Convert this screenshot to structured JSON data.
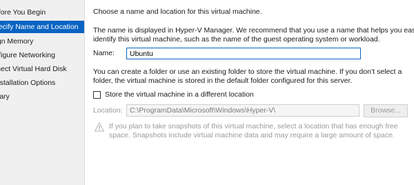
{
  "sidebar": {
    "items": [
      {
        "label": "Before You Begin",
        "active": false
      },
      {
        "label": "Specify Name and Location",
        "active": true
      },
      {
        "label": "Assign Memory",
        "active": false
      },
      {
        "label": "Configure Networking",
        "active": false
      },
      {
        "label": "Connect Virtual Hard Disk",
        "active": false
      },
      {
        "label": "Installation Options",
        "active": false
      },
      {
        "label": "Summary",
        "active": false
      }
    ]
  },
  "main": {
    "heading": "Choose a name and location for this virtual machine.",
    "description_line1": "The name is displayed in Hyper-V Manager. We recommend that you use a name that helps you easily",
    "description_line2": "identify this virtual machine, such as the name of the guest operating system or workload.",
    "name_label": "Name:",
    "name_value": "Ubuntu",
    "folder_line1": "You can create a folder or use an existing folder to store the virtual machine. If you don’t select a",
    "folder_line2": "folder, the virtual machine is stored in the default folder configured for this server.",
    "store_checkbox_label": "Store the virtual machine in a different location",
    "store_checked": false,
    "location_label": "Location:",
    "location_value": "C:\\ProgramData\\Microsoft\\Windows\\Hyper-V\\",
    "browse_label": "Browse...",
    "warning_line1": "If you plan to take snapshots of this virtual machine, select a location that has enough free",
    "warning_line2": "space. Snapshots include virtual machine data and may require a large amount of space."
  },
  "colors": {
    "accent": "#0a64c2",
    "sidebar_bg": "#f0f0f0",
    "disabled_text": "#9a9a9a"
  }
}
